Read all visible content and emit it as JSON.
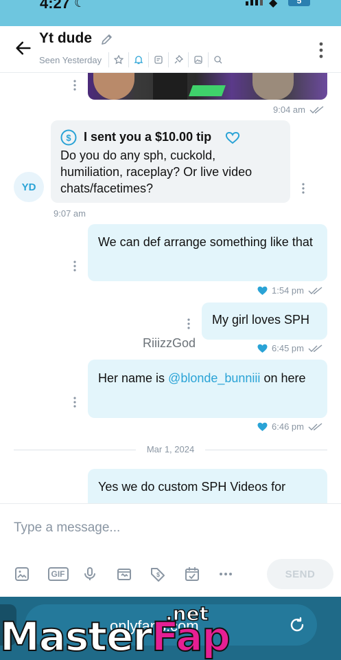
{
  "status_bar": {
    "time": "4:27",
    "battery": "5"
  },
  "header": {
    "title": "Yt dude",
    "seen": "Seen Yesterday",
    "icons": [
      "star-icon",
      "bell-icon",
      "note-icon",
      "pin-icon",
      "media-icon",
      "search-icon"
    ]
  },
  "messages": [
    {
      "type": "media",
      "direction": "in",
      "time": "9:04 am"
    },
    {
      "type": "tip",
      "direction": "in",
      "tip_label": "I sent you a $10.00 tip",
      "text": "Do you do any sph, cuckold, humiliation, raceplay? Or live video chats/facetimes?",
      "time": "9:07 am",
      "avatar_initials": "YD"
    },
    {
      "type": "text",
      "direction": "out",
      "text": "We can def arrange something like that",
      "time": "1:54 pm",
      "liked": true
    },
    {
      "type": "text",
      "direction": "out",
      "text": "My girl loves SPH",
      "time": "6:45 pm",
      "liked": true
    },
    {
      "type": "text",
      "direction": "out",
      "text_before": "Her name is ",
      "mention": "@blonde_bunniii",
      "text_after": " on here",
      "time": "6:46 pm",
      "liked": true
    },
    {
      "type": "text",
      "direction": "out",
      "text": "Yes we do custom SPH Videos for"
    }
  ],
  "sender_label": "RiiizzGod",
  "date_separator": "Mar 1, 2024",
  "composer": {
    "placeholder": "Type a message...",
    "gif_label": "GIF",
    "send_label": "SEND",
    "tools": [
      "image-icon",
      "gif-icon",
      "mic-icon",
      "vault-icon",
      "price-tag-icon",
      "schedule-icon",
      "more-icon"
    ]
  },
  "browser": {
    "url": "onlyfans.com"
  },
  "watermark": {
    "text_a": "Master",
    "text_b": "Fap",
    "suffix": ".net"
  },
  "colors": {
    "accent": "#2aa3d6",
    "out_bubble": "#e3f5fb",
    "in_bubble": "#f0f3f5",
    "browser_bar": "#1f6a88"
  }
}
